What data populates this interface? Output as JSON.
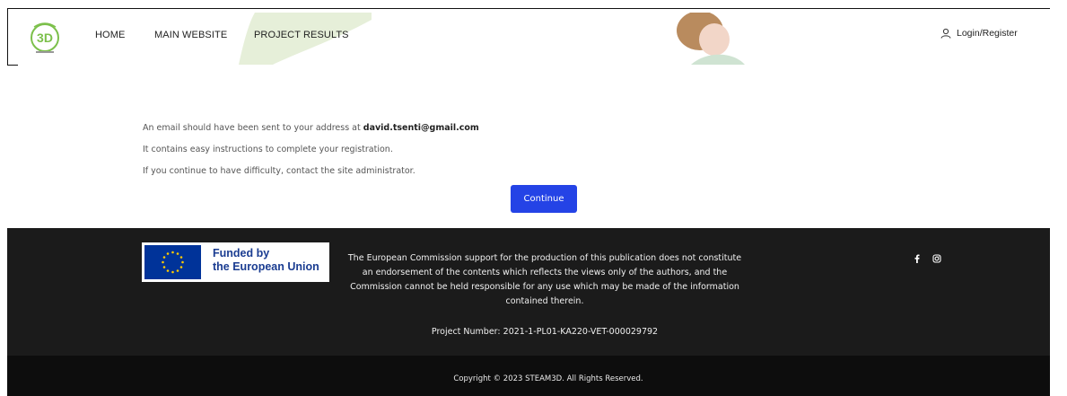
{
  "header": {
    "logo_icon": "steam3d-logo-icon",
    "nav": {
      "home": "HOME",
      "main_website": "MAIN WEBSITE",
      "project_results": "PROJECT RESULTS"
    },
    "login_label": "Login/Register",
    "login_icon": "user-icon"
  },
  "message": {
    "line1_prefix": "An email should have been sent to your address at",
    "email": "david.tsenti@gmail.com",
    "line2": "It contains easy instructions to complete your registration.",
    "line3": "If you continue to have difficulty, contact the site administrator.",
    "continue_label": "Continue"
  },
  "footer": {
    "eu_badge_line1": "Funded by",
    "eu_badge_line2": "the European Union",
    "disclaimer": "The European Commission support for the production of this publication does not constitute an endorsement of the contents which reflects the views only of the authors, and the Commission cannot be held responsible for any use which may be made of the information contained therein.",
    "project_number": "Project Number: 2021-1-PL01-KA220-VET-000029792",
    "social_icons": [
      "facebook-icon",
      "instagram-icon"
    ],
    "copyright": "Copyright © 2023 STEAM3D. All Rights Reserved."
  },
  "colors": {
    "button": "#2443e6",
    "footer_bg": "#1b1b1b",
    "copyright_bg": "#0d0d0d",
    "eu_blue": "#003399",
    "eu_star": "#ffcc00",
    "eu_text": "#1a3c91"
  }
}
